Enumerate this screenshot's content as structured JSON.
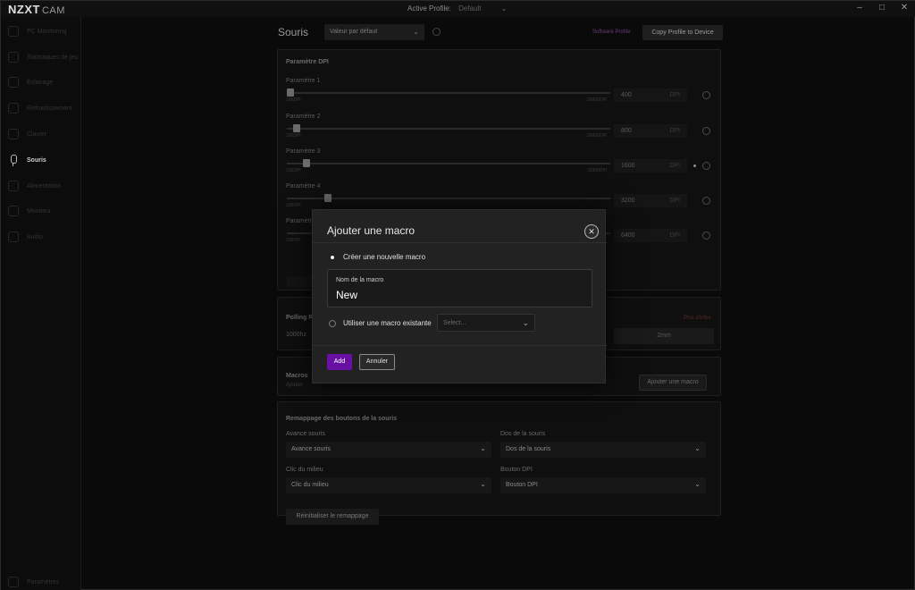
{
  "titlebar": {
    "logo": "NZXT",
    "logo_sub": "CAM",
    "active_profile_label": "Active Profile:",
    "active_profile_value": "Default",
    "minimize": "–",
    "maximize": "□",
    "close": "✕"
  },
  "sidebar": {
    "items": [
      {
        "label": "PC Monitoring",
        "icon": "monitor-icon"
      },
      {
        "label": "Statistiques de jeu",
        "icon": "game-icon"
      },
      {
        "label": "Éclairage",
        "icon": "lighting-icon"
      },
      {
        "label": "Refroidissement",
        "icon": "fan-icon"
      },
      {
        "label": "Clavier",
        "icon": "keyboard-icon"
      },
      {
        "label": "Souris",
        "icon": "mouse-icon"
      },
      {
        "label": "Alimentation",
        "icon": "power-icon"
      },
      {
        "label": "Moniteur",
        "icon": "display-icon"
      },
      {
        "label": "Audio",
        "icon": "audio-icon"
      }
    ],
    "active_index": 5,
    "bottom_item": "Paramètres"
  },
  "header": {
    "title": "Souris",
    "profile_select": "Valeur par défaut",
    "software_profile": "Software Profile",
    "copy_button": "Copy Profile to Device"
  },
  "dpi": {
    "section_title": "Paramètre DPI",
    "levels": [
      {
        "label": "Paramètre 1",
        "value": "400",
        "fraction": 0.0,
        "min": "100DPI",
        "max": "16000DPI",
        "unit": "DPI"
      },
      {
        "label": "Paramètre 2",
        "value": "800",
        "fraction": 0.02,
        "min": "100DPI",
        "max": "16000DPI",
        "unit": "DPI"
      },
      {
        "label": "Paramètre 3",
        "value": "1600",
        "fraction": 0.05,
        "min": "100DPI",
        "max": "16000DPI",
        "unit": "DPI"
      },
      {
        "label": "Paramètre 4",
        "value": "3200",
        "fraction": 0.12,
        "min": "100DPI",
        "max": "16000DPI",
        "unit": "DPI"
      },
      {
        "label": "Paramètre 5",
        "value": "6400",
        "fraction": 0.39,
        "min": "100DPI",
        "max": "16000DPI",
        "unit": "DPI"
      }
    ]
  },
  "polling": {
    "title": "Polling Rate",
    "value": "1000hz",
    "more_info": "Plus d'infos",
    "lift_off": "2mm"
  },
  "macros": {
    "title": "Macros",
    "subtitle": "Ajouter",
    "add_button": "Ajouter une macro"
  },
  "remap": {
    "title": "Remappage des boutons de la souris",
    "fields": [
      {
        "label": "Avance souris",
        "value": "Avance souris"
      },
      {
        "label": "Dos de la souris",
        "value": "Dos de la souris"
      },
      {
        "label": "Clic du milieu",
        "value": "Clic du milieu"
      },
      {
        "label": "Bouton DPI",
        "value": "Bouton DPI"
      }
    ],
    "reset_button": "Réinitialiser le remappage"
  },
  "modal": {
    "title": "Ajouter une macro",
    "close": "✕",
    "option_new": "Créer une nouvelle macro",
    "name_label": "Nom de la macro",
    "name_value": "New",
    "option_existing": "Utiliser une macro existante",
    "existing_placeholder": "Select...",
    "add_button": "Add",
    "cancel_button": "Annuler"
  },
  "colors": {
    "accent": "#6a0fa3",
    "background": "#0a0a0a",
    "modal": "#222222"
  }
}
